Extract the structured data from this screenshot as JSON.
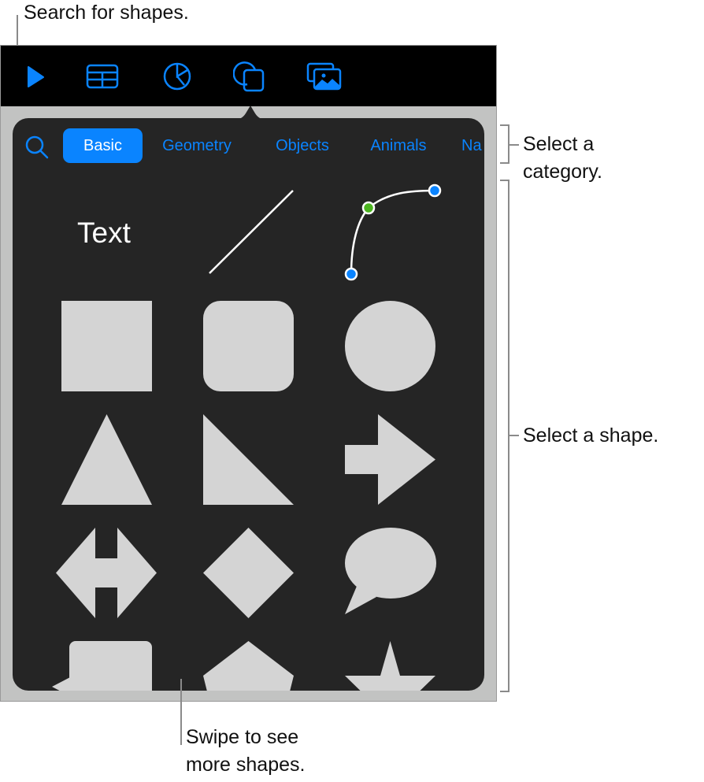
{
  "callouts": {
    "search": "Search for shapes.",
    "category_line1": "Select a",
    "category_line2": "category.",
    "shape": "Select a shape.",
    "swipe_line1": "Swipe to see",
    "swipe_line2": "more shapes."
  },
  "toolbar": {
    "items": [
      {
        "icon": "play-icon"
      },
      {
        "icon": "table-icon"
      },
      {
        "icon": "chart-icon"
      },
      {
        "icon": "shape-icon",
        "selected": true
      },
      {
        "icon": "media-icon"
      }
    ],
    "accent": "#0a84ff"
  },
  "popover": {
    "search_icon": "search-icon",
    "categories": [
      {
        "label": "Basic",
        "selected": true
      },
      {
        "label": "Geometry"
      },
      {
        "label": "Objects"
      },
      {
        "label": "Animals"
      },
      {
        "label": "Na"
      }
    ],
    "shapes": [
      {
        "name": "text",
        "label": "Text"
      },
      {
        "name": "line"
      },
      {
        "name": "curve"
      },
      {
        "name": "square"
      },
      {
        "name": "rounded-square"
      },
      {
        "name": "circle"
      },
      {
        "name": "triangle"
      },
      {
        "name": "right-triangle"
      },
      {
        "name": "arrow"
      },
      {
        "name": "double-arrow"
      },
      {
        "name": "diamond"
      },
      {
        "name": "speech-bubble"
      },
      {
        "name": "callout-rectangle"
      },
      {
        "name": "pentagon"
      },
      {
        "name": "star"
      }
    ],
    "shape_color": "#d4d4d4",
    "curve_point_colors": {
      "end": "#0a84ff",
      "mid": "#4cb520"
    }
  }
}
